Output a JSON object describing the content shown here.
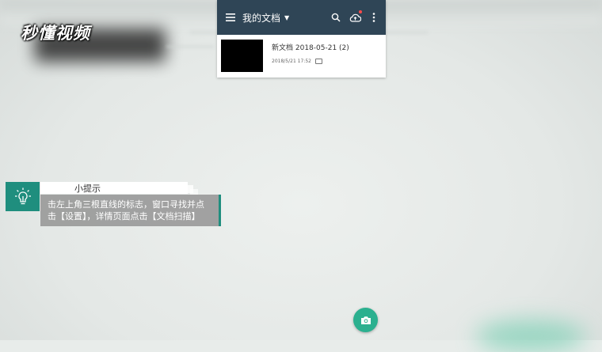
{
  "watermark": {
    "logo_text": "秒懂视频"
  },
  "app": {
    "title": "我的文档",
    "icons": {
      "menu": "hamburger-menu-icon",
      "dropdown": "caret-down-icon",
      "search": "search-icon",
      "cloud": "cloud-sync-icon",
      "more": "more-vert-icon"
    },
    "documents": [
      {
        "name": "新文档 2018-05-21 (2)",
        "date": "2018/5/21 17:52"
      }
    ],
    "colors": {
      "appbar": "#2f4556",
      "notification_dot": "#ff4a4a"
    }
  },
  "tip": {
    "title": "小提示",
    "body": "击左上角三根直线的标志，窗口寻找并点\n击【设置】，详情页面点击【文档扫描】",
    "accent": "#1f8e7e"
  },
  "fab": {
    "icon": "camera-icon",
    "color": "#2bb08f"
  }
}
